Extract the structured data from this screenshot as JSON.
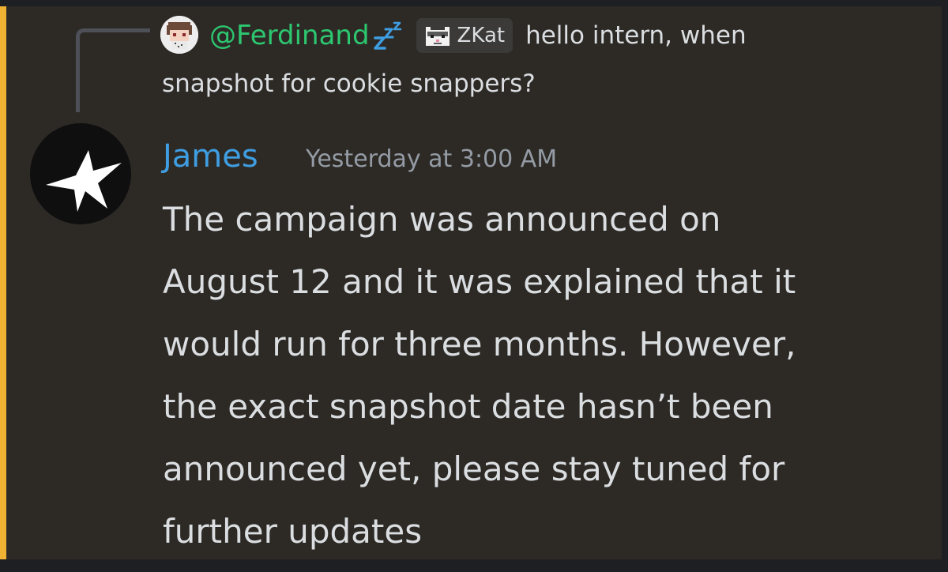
{
  "reply": {
    "username": "@Ferdinand",
    "status_icon": "zzz-sleep-icon",
    "tag": {
      "icon": "pixel-cat-icon",
      "label": "ZKat"
    },
    "text_line1": "hello intern, when",
    "text_line2": "snapshot for cookie snappers?"
  },
  "message": {
    "author": "James",
    "timestamp": "Yesterday at 3:00 AM",
    "avatar_icon": "sparkle-icon",
    "content": "The campaign was announced on\nAugust 12 and it was explained that it\nwould run for three months. However,\nthe exact snapshot date hasn’t been\nannounced yet, please stay tuned for\nfurther updates"
  },
  "colors": {
    "background": "#2d2a26",
    "accent_bar": "#f0b232",
    "reply_username": "#2dc770",
    "author_name": "#3f9ee2",
    "timestamp": "#949ba4",
    "text": "#dbdee1"
  }
}
